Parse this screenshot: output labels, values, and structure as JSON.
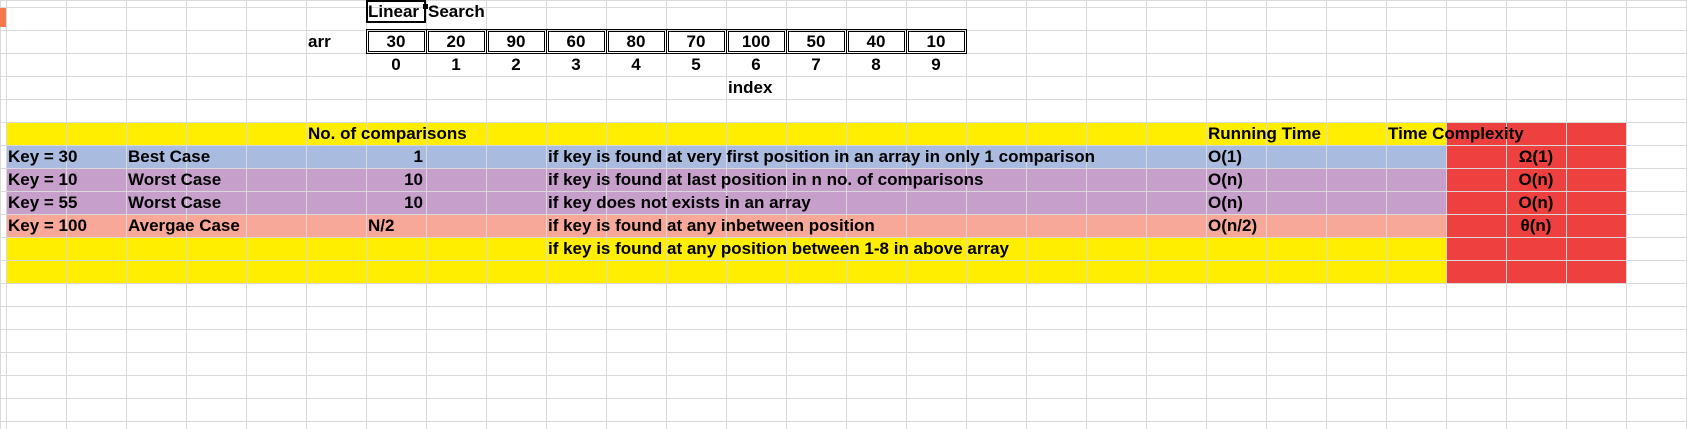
{
  "title": {
    "part1": "Linear",
    "part2": "Search"
  },
  "array": {
    "label": "arr",
    "values": [
      "30",
      "20",
      "90",
      "60",
      "80",
      "70",
      "100",
      "50",
      "40",
      "10"
    ],
    "indices": [
      "0",
      "1",
      "2",
      "3",
      "4",
      "5",
      "6",
      "7",
      "8",
      "9"
    ],
    "index_label": "index"
  },
  "table": {
    "header": {
      "comparisons": "No. of comparisons",
      "running_time": "Running Time",
      "time_complexity": "Time Complexity"
    },
    "rows": [
      {
        "key": "Key = 30",
        "case": "Best Case",
        "comparisons": "1",
        "description": "if key is found at very first position in an array in only 1 comparison",
        "running_time": "O(1)",
        "complexity": "Ω(1)"
      },
      {
        "key": "Key = 10",
        "case": "Worst Case",
        "comparisons": "10",
        "description": "if key is found at last position in n no. of comparisons",
        "running_time": "O(n)",
        "complexity": "O(n)"
      },
      {
        "key": "Key = 55",
        "case": "Worst Case",
        "comparisons": "10",
        "description": "if key does not exists in an array",
        "running_time": "O(n)",
        "complexity": "O(n)"
      },
      {
        "key": "Key = 100",
        "case": "Avergae Case",
        "comparisons": "N/2",
        "description": "if key is found at any inbetween position",
        "running_time": "O(n/2)",
        "complexity": "θ(n)"
      }
    ],
    "note": "if key is found at any position between 1-8 in above array"
  },
  "colors": {
    "yellow": "#ffee00",
    "blue": "#aabbe0",
    "purple": "#c69fcb",
    "salmon": "#f8a898",
    "red": "#ef4040",
    "gridline": "#d9d9d9"
  }
}
